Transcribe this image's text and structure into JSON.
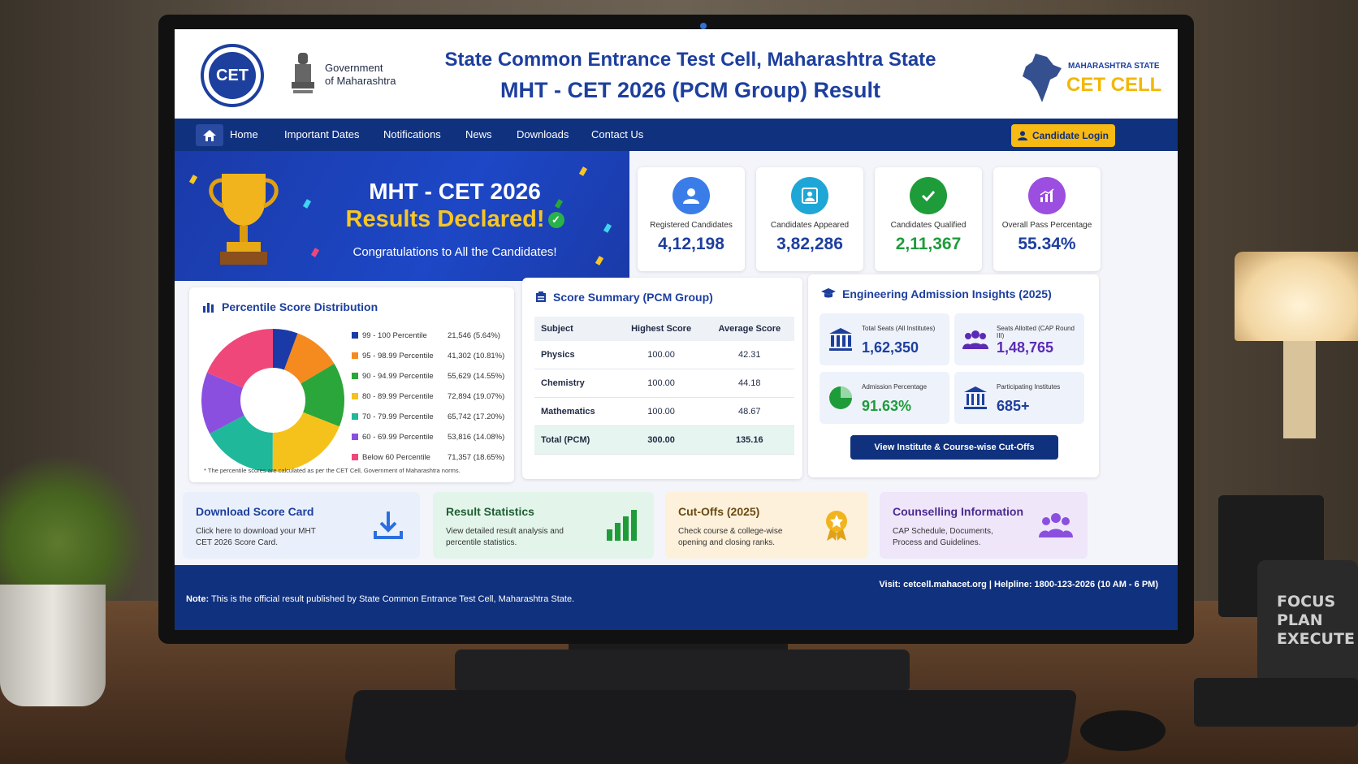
{
  "header": {
    "title": "State Common Entrance Test Cell, Maharashtra State",
    "subtitle": "MHT - CET 2026 (PCM Group) Result",
    "logo_text": "CET",
    "gov_text": "Government\nof Maharashtra",
    "cc_small": "MAHARASHTRA STATE",
    "cc_big": "CET CELL"
  },
  "nav": {
    "items": [
      "Home",
      "Important Dates",
      "Notifications",
      "News",
      "Downloads",
      "Contact Us"
    ],
    "login": "Candidate Login"
  },
  "banner": {
    "title": "MHT - CET 2026",
    "subtitle": "Results Declared!",
    "message": "Congratulations to All the Candidates!"
  },
  "stats": [
    {
      "label": "Registered Candidates",
      "value": "4,12,198",
      "color": "#1d3f9e",
      "icon": "user-icon"
    },
    {
      "label": "Candidates Appeared",
      "value": "3,82,286",
      "color": "#1d3f9e",
      "icon": "appeared-icon"
    },
    {
      "label": "Candidates Qualified",
      "value": "2,11,367",
      "color": "#1f9c3a",
      "icon": "check-icon"
    },
    {
      "label": "Overall Pass Percentage",
      "value": "55.34%",
      "color": "#1d3f9e",
      "icon": "chart-icon"
    }
  ],
  "percentile": {
    "title": "Percentile Score Distribution",
    "legend": [
      {
        "label": "99 - 100 Percentile",
        "value": "21,546 (5.64%)",
        "color": "#1a3aa8"
      },
      {
        "label": "95 - 98.99 Percentile",
        "value": "41,302 (10.81%)",
        "color": "#f58a1f"
      },
      {
        "label": "90 - 94.99 Percentile",
        "value": "55,629 (14.55%)",
        "color": "#2aa63a"
      },
      {
        "label": "80 - 89.99 Percentile",
        "value": "72,894 (19.07%)",
        "color": "#f5c21b"
      },
      {
        "label": "70 - 79.99 Percentile",
        "value": "65,742 (17.20%)",
        "color": "#1fb89a"
      },
      {
        "label": "60 - 69.99 Percentile",
        "value": "53,816 (14.08%)",
        "color": "#8b4fe0"
      },
      {
        "label": "Below 60 Percentile",
        "value": "71,357 (18.65%)",
        "color": "#f0477a"
      }
    ],
    "note": "* The percentile scores are calculated as per the CET Cell, Government of Maharashtra norms."
  },
  "chart_data": {
    "type": "pie",
    "categories": [
      "99 - 100 Percentile",
      "95 - 98.99 Percentile",
      "90 - 94.99 Percentile",
      "80 - 89.99 Percentile",
      "70 - 79.99 Percentile",
      "60 - 69.99 Percentile",
      "Below 60 Percentile"
    ],
    "values": [
      5.64,
      10.81,
      14.55,
      19.07,
      17.2,
      14.08,
      18.65
    ],
    "counts": [
      21546,
      41302,
      55629,
      72894,
      65742,
      53816,
      71357
    ],
    "title": "Percentile Score Distribution",
    "legend_position": "right"
  },
  "score_summary": {
    "title": "Score Summary (PCM Group)",
    "headers": [
      "Subject",
      "Highest Score",
      "Average Score"
    ],
    "rows": [
      [
        "Physics",
        "100.00",
        "42.31"
      ],
      [
        "Chemistry",
        "100.00",
        "44.18"
      ],
      [
        "Mathematics",
        "100.00",
        "48.67"
      ],
      [
        "Total (PCM)",
        "300.00",
        "135.16"
      ]
    ]
  },
  "insights": {
    "title": "Engineering Admission Insights (2025)",
    "cards": [
      {
        "label": "Total Seats (All Institutes)",
        "value": "1,62,350",
        "color": "#1d3f9e"
      },
      {
        "label": "Seats Allotted (CAP Round III)",
        "value": "1,48,765",
        "color": "#5b2bb5"
      },
      {
        "label": "Admission Percentage",
        "value": "91.63%",
        "color": "#1f9c3a"
      },
      {
        "label": "Participating Institutes",
        "value": "685+",
        "color": "#1d3f9e"
      }
    ],
    "button": "View Institute & Course-wise Cut-Offs"
  },
  "bottom_cards": [
    {
      "title": "Download Score Card",
      "desc": "Click here to download your MHT CET 2026 Score Card.",
      "bg": "#eaf0fb",
      "color": "#1d3f9e"
    },
    {
      "title": "Result Statistics",
      "desc": "View detailed result analysis and percentile statistics.",
      "bg": "#e3f5ea",
      "color": "#1f5e33"
    },
    {
      "title": "Cut-Offs (2025)",
      "desc": "Check course & college-wise opening and closing ranks.",
      "bg": "#fdf1dc",
      "color": "#6b4a12"
    },
    {
      "title": "Counselling Information",
      "desc": "CAP Schedule, Documents, Process and Guidelines.",
      "bg": "#efe6fa",
      "color": "#4b2a8f"
    }
  ],
  "footer": {
    "note_label": "Note:",
    "note": "This is the official result published by State Common Entrance Test Cell, Maharashtra State.",
    "visit": "Visit: cetcell.mahacet.org  |  Helpline: 1800-123-2026 (10 AM - 6 PM)"
  },
  "desk": {
    "mug_text": "FOCUS\nPLAN\nEXECUTE"
  }
}
